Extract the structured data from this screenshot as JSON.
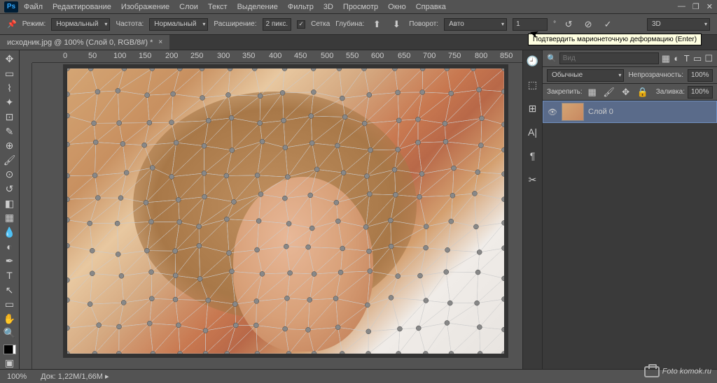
{
  "app": "Ps",
  "menu": [
    "Файл",
    "Редактирование",
    "Изображение",
    "Слои",
    "Текст",
    "Выделение",
    "Фильтр",
    "3D",
    "Просмотр",
    "Окно",
    "Справка"
  ],
  "options": {
    "mode_lbl": "Режим:",
    "mode_val": "Нормальный",
    "freq_lbl": "Частота:",
    "freq_val": "Нормальный",
    "expand_lbl": "Расширение:",
    "expand_val": "2 пикс.",
    "mesh_lbl": "Сетка",
    "depth_lbl": "Глубина:",
    "rotate_lbl": "Поворот:",
    "rotate_val": "Авто",
    "num": "1"
  },
  "tooltip": "Подтвердить марионеточную деформацию (Enter)",
  "tab": {
    "title": "исходник.jpg @ 100% (Слой 0, RGB/8#) *"
  },
  "threeD": "3D",
  "right": {
    "search_ph": "Вид",
    "blend": "Обычные",
    "opacity_lbl": "Непрозрачность:",
    "opacity": "100%",
    "lock_lbl": "Закрепить:",
    "fill_lbl": "Заливка:",
    "fill": "100%",
    "layer0": "Слой 0"
  },
  "status": {
    "zoom": "100%",
    "doc_lbl": "Док:",
    "doc": "1,22M/1,66M"
  },
  "watermark": "Foto komok.ru",
  "ruler": [
    "0",
    "50",
    "100",
    "150",
    "200",
    "250",
    "300",
    "350",
    "400",
    "450",
    "500",
    "550",
    "600",
    "650",
    "700",
    "750",
    "800",
    "850"
  ]
}
